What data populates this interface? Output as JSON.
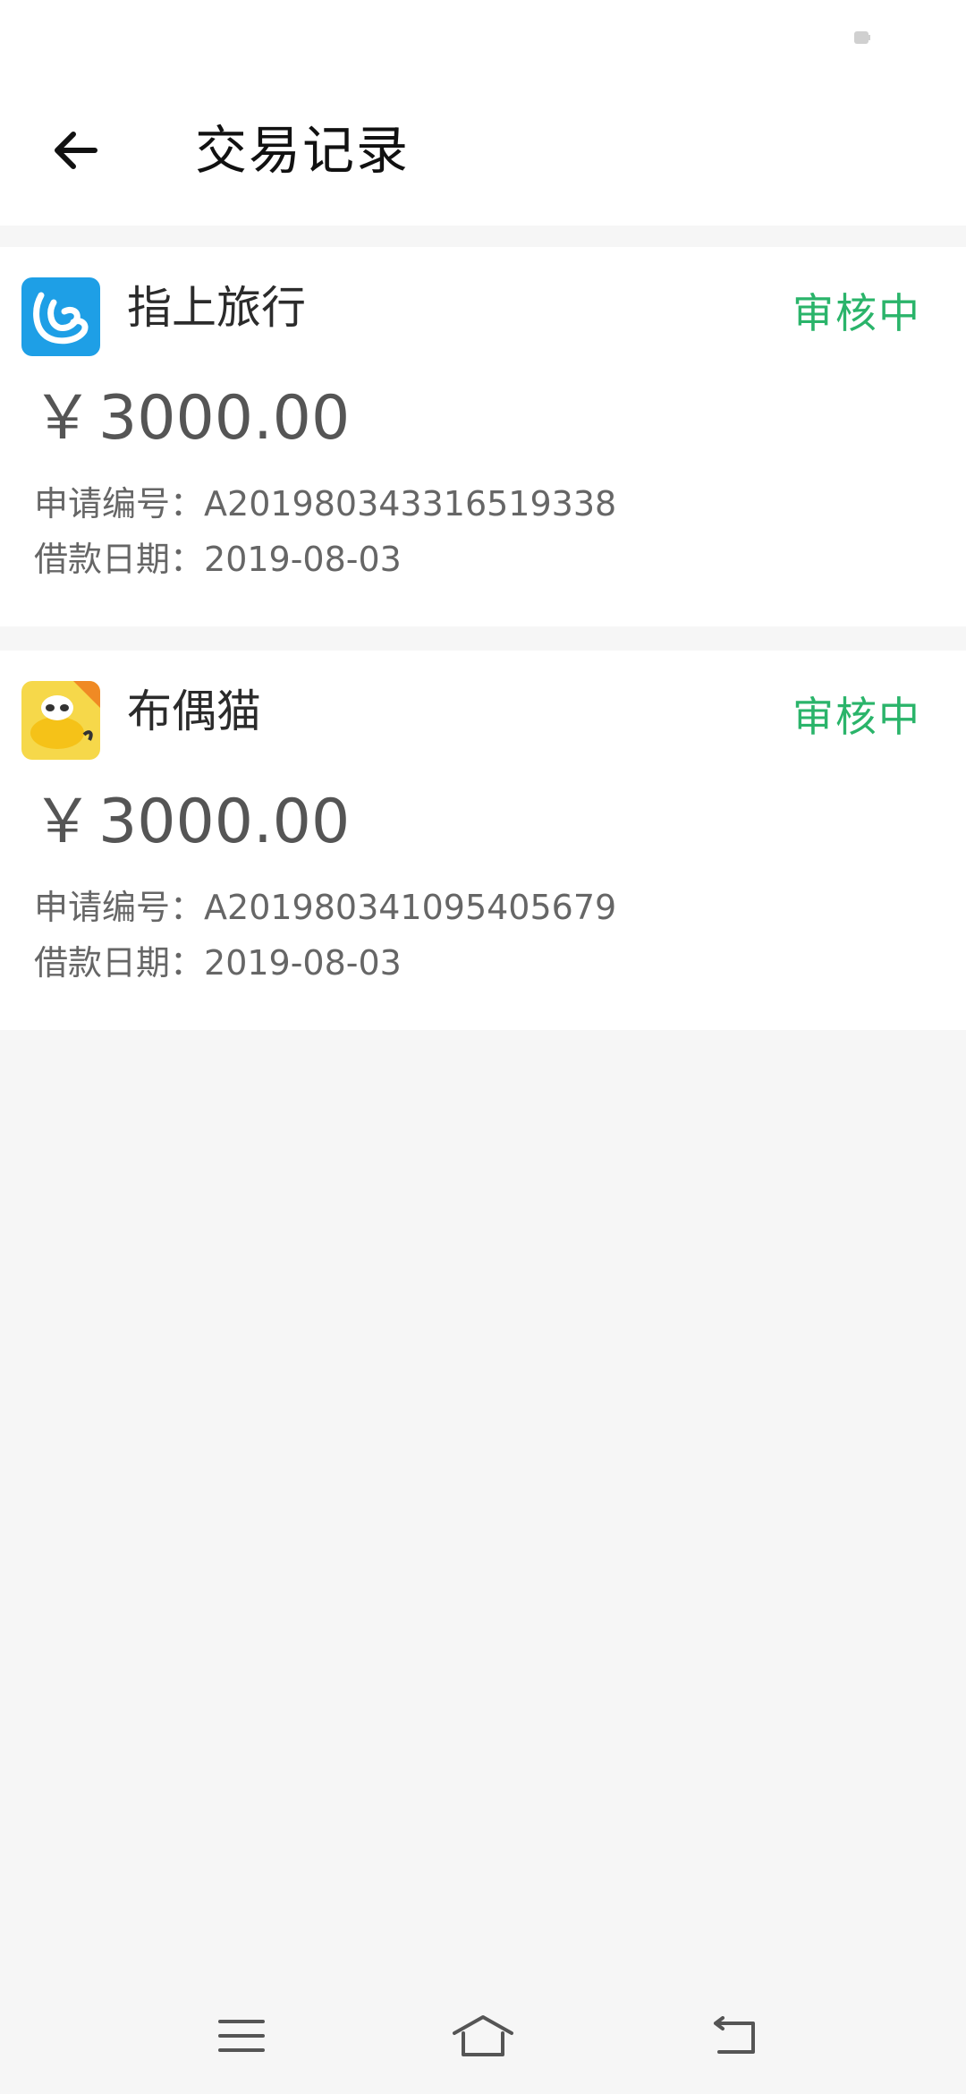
{
  "header": {
    "title": "交易记录",
    "back_icon": "arrow-left-icon"
  },
  "records": [
    {
      "app_name": "指上旅行",
      "app_icon": "zhishang-travel-logo",
      "status": "审核中",
      "currency": "￥",
      "amount": "3000.00",
      "application_no_label": "申请编号：",
      "application_no": "A201980343316519338",
      "loan_date_label": "借款日期：",
      "loan_date": "2019-08-03"
    },
    {
      "app_name": "布偶猫",
      "app_icon": "ragdoll-cat-logo",
      "status": "审核中",
      "currency": "￥",
      "amount": "3000.00",
      "application_no_label": "申请编号：",
      "application_no": "A201980341095405679",
      "loan_date_label": "借款日期：",
      "loan_date": "2019-08-03"
    }
  ],
  "nav": {
    "menu_icon": "menu-icon",
    "home_icon": "home-icon",
    "back_icon": "back-icon"
  },
  "colors": {
    "status_green": "#2ab46a",
    "background": "#f6f6f6",
    "card": "#ffffff"
  }
}
